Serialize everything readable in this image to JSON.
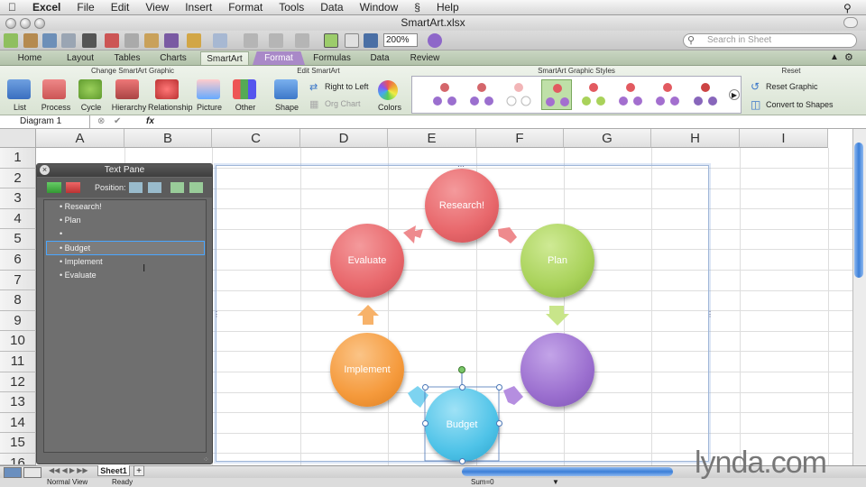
{
  "menubar": {
    "app": "Excel",
    "items": [
      "File",
      "Edit",
      "View",
      "Insert",
      "Format",
      "Tools",
      "Data",
      "Window",
      "Help"
    ]
  },
  "window": {
    "title": "SmartArt.xlsx"
  },
  "toolbar": {
    "zoom": "200%",
    "search_placeholder": "Search in Sheet"
  },
  "ribbon_tabs": [
    "Home",
    "Layout",
    "Tables",
    "Charts",
    "SmartArt",
    "Format",
    "Formulas",
    "Data",
    "Review"
  ],
  "ribbon": {
    "group_change": "Change SmartArt Graphic",
    "group_edit": "Edit SmartArt",
    "group_styles": "SmartArt Graphic Styles",
    "group_reset": "Reset",
    "buttons": [
      "List",
      "Process",
      "Cycle",
      "Hierarchy",
      "Relationship",
      "Picture",
      "Other"
    ],
    "shape_label": "Shape",
    "right_to_left": "Right to Left",
    "org_chart": "Org Chart",
    "colors_label": "Colors",
    "reset_graphic": "Reset Graphic",
    "convert_to_shapes": "Convert to Shapes"
  },
  "formula_bar": {
    "name_box": "Diagram 1",
    "fx": "fx"
  },
  "columns": [
    "A",
    "B",
    "C",
    "D",
    "E",
    "F",
    "G",
    "H",
    "I"
  ],
  "rows": [
    "1",
    "2",
    "3",
    "4",
    "5",
    "6",
    "7",
    "8",
    "9",
    "10",
    "11",
    "12",
    "13",
    "14",
    "15",
    "16"
  ],
  "text_pane": {
    "title": "Text Pane",
    "position_label": "Position:",
    "items": [
      "Research!",
      "Plan",
      "",
      "Budget",
      "Implement",
      "Evaluate"
    ]
  },
  "smartart": {
    "nodes": [
      {
        "label": "Research!",
        "color": "#e8676b"
      },
      {
        "label": "Plan",
        "color": "#a9d25a"
      },
      {
        "label": "",
        "color": "#9b6fcf"
      },
      {
        "label": "Budget",
        "color": "#4fc3e8"
      },
      {
        "label": "Implement",
        "color": "#f59a3c"
      },
      {
        "label": "Evaluate",
        "color": "#e8676b"
      }
    ]
  },
  "sheet_tab": "Sheet1",
  "status": {
    "view": "Normal View",
    "ready": "Ready",
    "sum": "Sum=0"
  },
  "watermark": "lynda.com"
}
